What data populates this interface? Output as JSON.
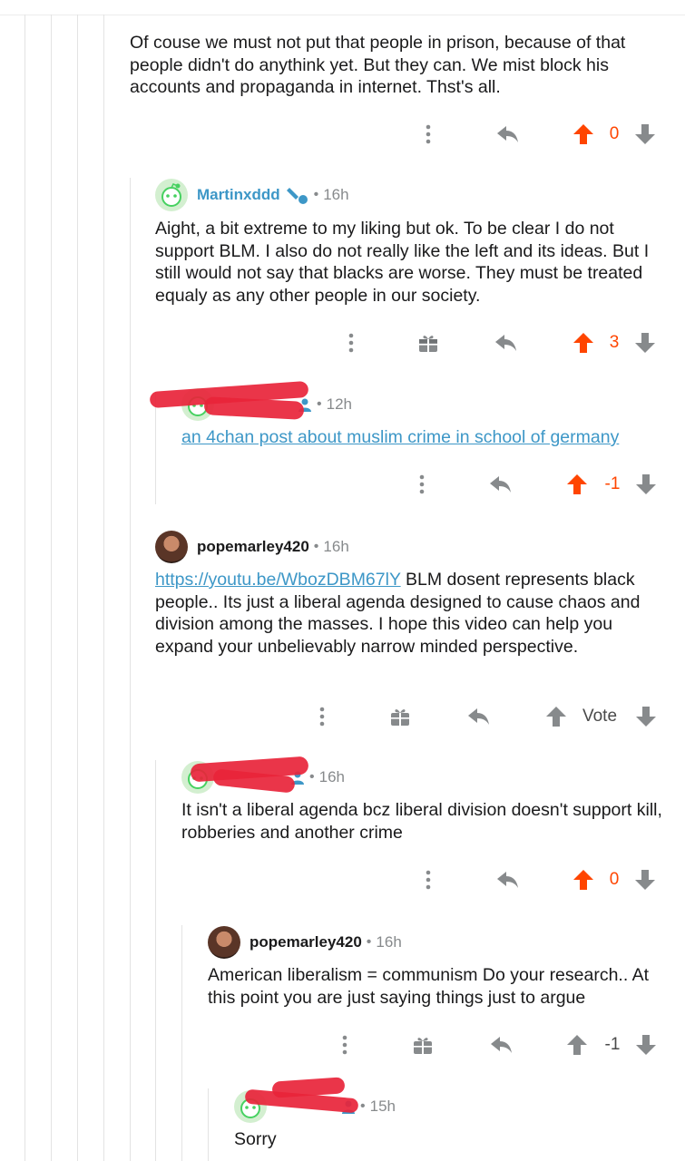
{
  "comments": [
    {
      "text": "Of couse we must not put that people in prison, because of that people didn't do anythink yet. But they can. We mist block his accounts and propaganda in internet. Thst's all.",
      "votes": "0",
      "upvoted": true
    },
    {
      "username": "Martinxddd",
      "time": "16h",
      "text": "Aight, a bit extreme to my liking but ok. To be clear I do not support BLM. I also do not really like the left and its ideas. But I still would not say that blacks are worse. They must be treated equaly as any other people in our society.",
      "votes": "3",
      "upvoted": true
    },
    {
      "username": "",
      "time": "12h",
      "link_text": "an 4chan post about muslim crime in school of germany",
      "votes": "-1",
      "upvoted": true
    },
    {
      "username": "popemarley420",
      "time": "16h",
      "link_text": "https://youtu.be/WbozDBM67lY",
      "text": " BLM dosent represents black people.. Its just a liberal agenda designed to cause chaos and division among the masses. I hope this video can help you expand your unbelievably narrow minded perspective.",
      "votes": "Vote",
      "upvoted": false
    },
    {
      "username": "",
      "time": "16h",
      "text": "It isn't a liberal agenda bcz liberal division doesn't support kill, robberies and another crime",
      "votes": "0",
      "upvoted": true
    },
    {
      "username": "popemarley420",
      "time": "16h",
      "text": "American liberalism = communism Do your research.. At this point you are just saying things just to argue",
      "votes": "-1",
      "upvoted": false
    },
    {
      "username": "",
      "time": "15h",
      "text": "Sorry"
    }
  ],
  "icons": {
    "more": "more-vertical-icon",
    "award": "gift-award-icon",
    "reply": "reply-arrow-icon",
    "upvote": "upvote-arrow-icon",
    "downvote": "downvote-arrow-icon",
    "mod": "pencil-flair-icon"
  },
  "colors": {
    "upvote_active": "#ff4500",
    "username_link": "#3d97c7",
    "meta_gray": "#878a8c",
    "thread_line": "#e3e3e3",
    "redaction": "#e8243a"
  }
}
